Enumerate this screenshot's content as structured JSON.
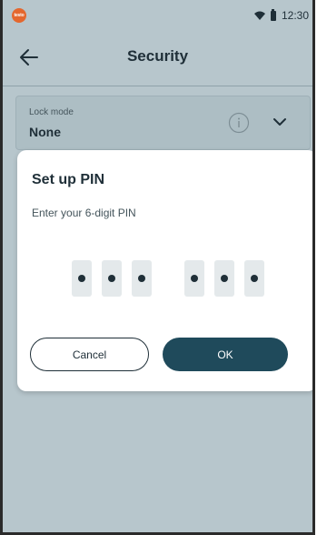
{
  "status_bar": {
    "app_logo_text": "testo",
    "time": "12:30",
    "icons": [
      "wifi-icon",
      "battery-icon"
    ]
  },
  "app_bar": {
    "title": "Security",
    "back_icon": "arrow-left-icon"
  },
  "lock_mode": {
    "label": "Lock mode",
    "value": "None",
    "info_icon": "info-icon",
    "dropdown_icon": "chevron-down-icon"
  },
  "dialog": {
    "title": "Set up PIN",
    "subtitle": "Enter your 6-digit PIN",
    "pin_entered_count": 6,
    "pin_length": 6,
    "cancel_label": "Cancel",
    "ok_label": "OK"
  },
  "colors": {
    "background_scrim": "#b7c6cc",
    "primary": "#1f4a5b",
    "text": "#1f2f38",
    "logo": "#e4672e"
  }
}
